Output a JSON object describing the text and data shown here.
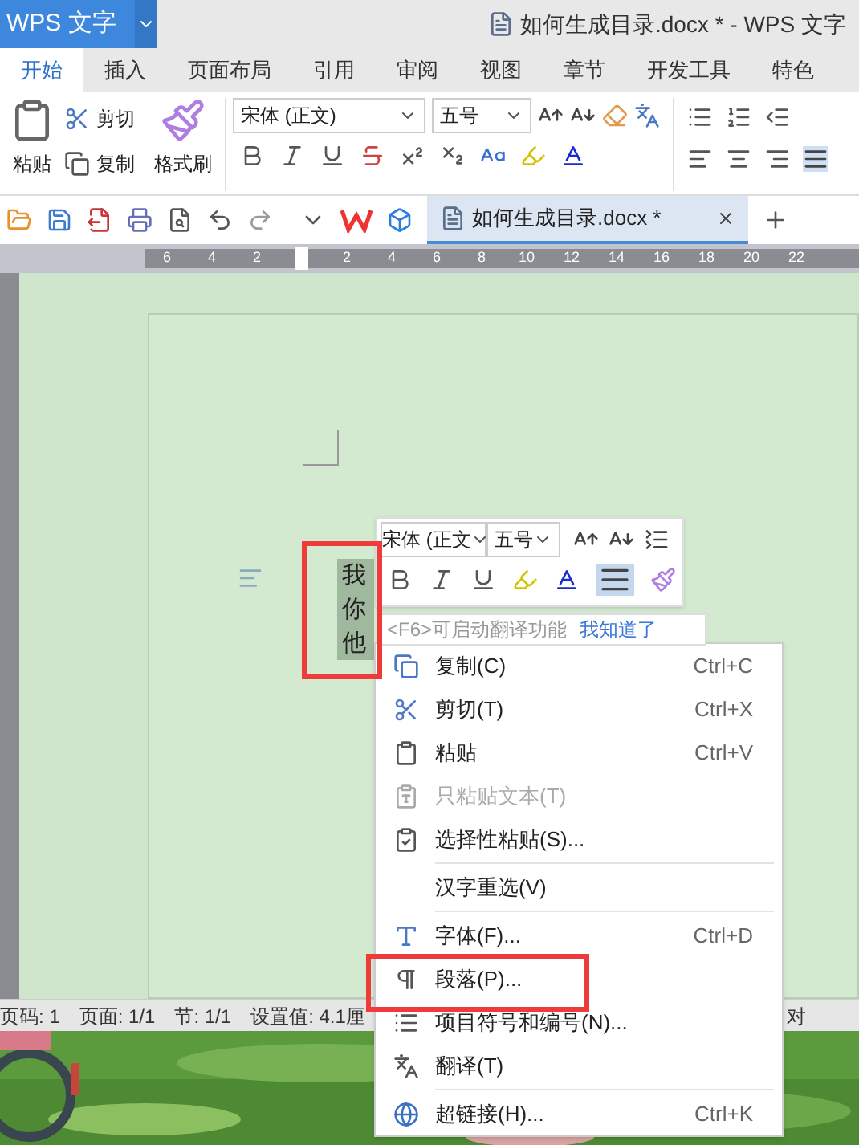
{
  "app_menu": {
    "label": "WPS 文字"
  },
  "window": {
    "title": "如何生成目录.docx * - WPS 文字"
  },
  "ribbon_tabs": [
    {
      "label": "开始",
      "selected": true
    },
    {
      "label": "插入",
      "selected": false
    },
    {
      "label": "页面布局",
      "selected": false
    },
    {
      "label": "引用",
      "selected": false
    },
    {
      "label": "审阅",
      "selected": false
    },
    {
      "label": "视图",
      "selected": false
    },
    {
      "label": "章节",
      "selected": false
    },
    {
      "label": "开发工具",
      "selected": false
    },
    {
      "label": "特色",
      "selected": false
    }
  ],
  "ribbon": {
    "paste": "粘贴",
    "cut": "剪切",
    "copy": "复制",
    "format_painter": "格式刷",
    "font": "宋体 (正文)",
    "size": "五号"
  },
  "doc_tab": {
    "title": "如何生成目录.docx *"
  },
  "ruler": {
    "ticks": [
      "6",
      "4",
      "2",
      "2",
      "4",
      "6",
      "8",
      "10",
      "12",
      "14",
      "16",
      "18",
      "20",
      "22"
    ]
  },
  "document": {
    "text": "我你他"
  },
  "mini_toolbar": {
    "font": "宋体 (正文",
    "size": "五号"
  },
  "tooltip": {
    "text": "<F6>可启动翻译功能",
    "link": "我知道了"
  },
  "context_menu": [
    {
      "label": "复制(C)",
      "shortcut": "Ctrl+C",
      "disabled": false,
      "separator_before": false
    },
    {
      "label": "剪切(T)",
      "shortcut": "Ctrl+X",
      "disabled": false,
      "separator_before": false
    },
    {
      "label": "粘贴",
      "shortcut": "Ctrl+V",
      "disabled": false,
      "separator_before": false
    },
    {
      "label": "只粘贴文本(T)",
      "disabled": true,
      "separator_before": false
    },
    {
      "label": "选择性粘贴(S)...",
      "disabled": false,
      "separator_before": false
    },
    {
      "label": "汉字重选(V)",
      "disabled": false,
      "separator_before": true
    },
    {
      "label": "字体(F)...",
      "shortcut": "Ctrl+D",
      "disabled": false,
      "separator_before": true
    },
    {
      "label": "段落(P)...",
      "disabled": false,
      "separator_before": false
    },
    {
      "label": "项目符号和编号(N)...",
      "disabled": false,
      "separator_before": false
    },
    {
      "label": "翻译(T)",
      "disabled": false,
      "separator_before": false
    },
    {
      "label": "超链接(H)...",
      "shortcut": "Ctrl+K",
      "disabled": false,
      "separator_before": true
    }
  ],
  "status_bar": [
    "页码: 1",
    "页面: 1/1",
    "节: 1/1",
    "设置值: 4.1厘"
  ],
  "status_right": "对"
}
